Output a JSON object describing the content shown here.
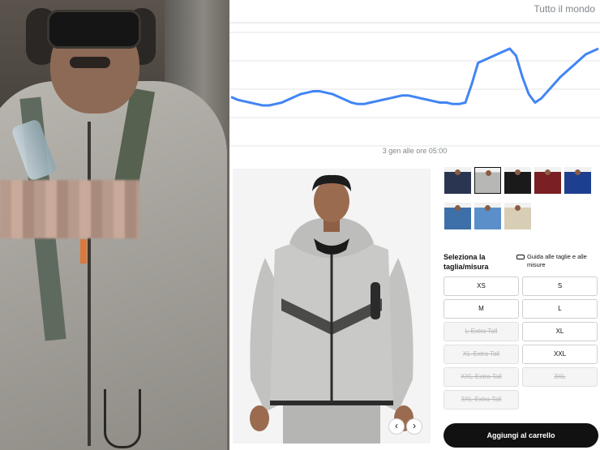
{
  "trends": {
    "scope_label": "Tutto il mondo",
    "date_label": "3 gen alle ore 05:00",
    "line_color": "#4285f4",
    "series": [
      46,
      44,
      43,
      42,
      41,
      40,
      40,
      41,
      42,
      44,
      46,
      48,
      49,
      50,
      50,
      49,
      48,
      46,
      44,
      42,
      41,
      41,
      42,
      43,
      44,
      45,
      46,
      47,
      47,
      46,
      45,
      44,
      43,
      42,
      42,
      41,
      41,
      42,
      55,
      70,
      72,
      74,
      76,
      78,
      80,
      75,
      60,
      48,
      42,
      45,
      50,
      55,
      60,
      64,
      68,
      72,
      76,
      78,
      80
    ]
  },
  "product": {
    "image_alt": "Nike Tech Fleece hoodie grigio",
    "prev_icon": "chevron-left-icon",
    "next_icon": "chevron-right-icon",
    "prev_glyph": "‹",
    "next_glyph": "›"
  },
  "thumbnails": [
    {
      "name": "navy",
      "color": "#2a3552",
      "selected": false
    },
    {
      "name": "grey",
      "color": "#b7b7b5",
      "selected": true
    },
    {
      "name": "black",
      "color": "#1a1a1a",
      "selected": false
    },
    {
      "name": "red",
      "color": "#7a1f22",
      "selected": false
    },
    {
      "name": "blue",
      "color": "#1e3f8f",
      "selected": false
    },
    {
      "name": "light-blue",
      "color": "#3d6fa8",
      "selected": false
    },
    {
      "name": "sky",
      "color": "#5b8fc9",
      "selected": false
    },
    {
      "name": "sand",
      "color": "#d8cdb5",
      "selected": false
    }
  ],
  "sizes": {
    "title": "Seleziona la taglia/misura",
    "guide_label": "Guida alle taglie e alle misure",
    "guide_icon": "ruler-icon",
    "options": [
      {
        "label": "XS",
        "available": true
      },
      {
        "label": "S",
        "available": true
      },
      {
        "label": "M",
        "available": true
      },
      {
        "label": "L",
        "available": true
      },
      {
        "label": "L-Extra Tall",
        "available": false
      },
      {
        "label": "XL",
        "available": true
      },
      {
        "label": "XL-Extra Tall",
        "available": false
      },
      {
        "label": "XXL",
        "available": true
      },
      {
        "label": "XXL-Extra Tall",
        "available": false
      },
      {
        "label": "3XL",
        "available": false
      },
      {
        "label": "3XL-Extra Tall",
        "available": false
      }
    ]
  },
  "cart": {
    "add_label": "Aggiungi al carrello"
  }
}
